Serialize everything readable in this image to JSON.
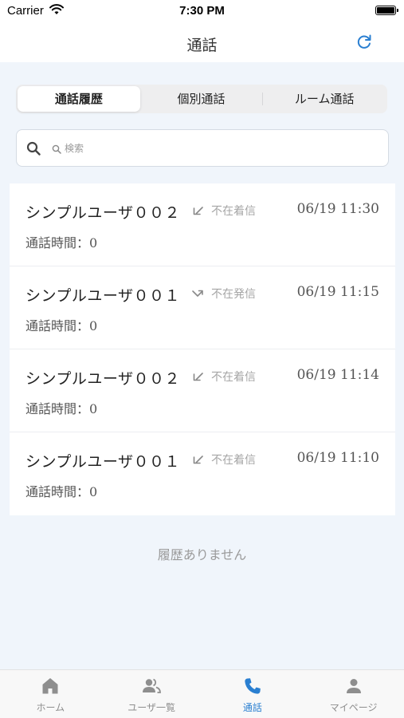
{
  "status_bar": {
    "carrier": "Carrier",
    "time": "7:30 PM"
  },
  "nav": {
    "title": "通話"
  },
  "segments": [
    "通話履歴",
    "個別通話",
    "ルーム通話"
  ],
  "search": {
    "placeholder": "検索"
  },
  "calls": [
    {
      "name": "シンプルユーザ００２",
      "direction": "incoming",
      "status": "不在着信",
      "time": "06/19 11:30",
      "duration": "通話時間：0"
    },
    {
      "name": "シンプルユーザ００１",
      "direction": "outgoing",
      "status": "不在発信",
      "time": "06/19 11:15",
      "duration": "通話時間：0"
    },
    {
      "name": "シンプルユーザ００２",
      "direction": "incoming",
      "status": "不在着信",
      "time": "06/19 11:14",
      "duration": "通話時間：0"
    },
    {
      "name": "シンプルユーザ００１",
      "direction": "incoming",
      "status": "不在着信",
      "time": "06/19 11:10",
      "duration": "通話時間：0"
    }
  ],
  "empty_text": "履歴ありません",
  "tabs": [
    {
      "label": "ホーム",
      "icon": "home-icon"
    },
    {
      "label": "ユーザ一覧",
      "icon": "users-icon"
    },
    {
      "label": "通話",
      "icon": "phone-icon"
    },
    {
      "label": "マイページ",
      "icon": "person-icon"
    }
  ],
  "colors": {
    "accent": "#2a7fd1",
    "background": "#f0f5fb",
    "inactive": "#8e8e8e"
  }
}
